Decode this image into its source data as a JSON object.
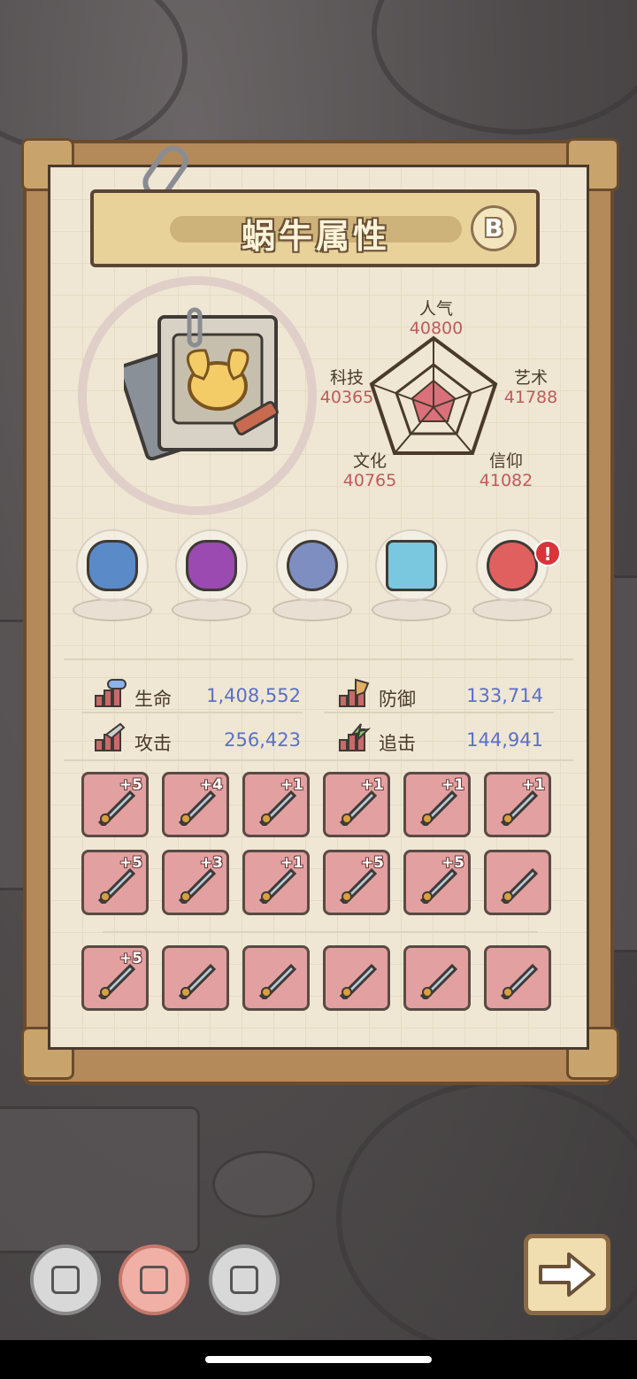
{
  "title": "蜗牛属性",
  "grade": "B",
  "attributes": [
    {
      "name": "人气",
      "value": "40800"
    },
    {
      "name": "艺术",
      "value": "41788"
    },
    {
      "name": "信仰",
      "value": "41082"
    },
    {
      "name": "文化",
      "value": "40765"
    },
    {
      "name": "科技",
      "value": "40365"
    }
  ],
  "relics": [
    {
      "icon": "maw-relic-icon",
      "color": "#5a8ac8"
    },
    {
      "icon": "shell-heart-relic-icon",
      "color": "#9a4ab0"
    },
    {
      "icon": "compass-relic-icon",
      "color": "#7e8ec0"
    },
    {
      "icon": "eye-tablet-relic-icon",
      "color": "#7ac8e0"
    },
    {
      "icon": "swirl-orb-relic-icon",
      "color": "#e06060"
    }
  ],
  "alert_badge": "!",
  "stats": {
    "hp": {
      "label": "生命",
      "value": "1,408,552"
    },
    "defense": {
      "label": "防御",
      "value": "133,714"
    },
    "attack": {
      "label": "攻击",
      "value": "256,423"
    },
    "chase": {
      "label": "追击",
      "value": "144,941"
    }
  },
  "equipment_rows": [
    [
      {
        "icon": "sword-icon",
        "level": "+5"
      },
      {
        "icon": "crossbow-icon",
        "level": "+4"
      },
      {
        "icon": "spiked-club-icon",
        "level": "+1"
      },
      {
        "icon": "flame-sword-icon",
        "level": "+1"
      },
      {
        "icon": "dagger-icon",
        "level": "+1"
      },
      {
        "icon": "axe-icon",
        "level": "+1"
      }
    ],
    [
      {
        "icon": "curved-knife-icon",
        "level": "+5"
      },
      {
        "icon": "serpent-staff-icon",
        "level": "+3"
      },
      {
        "icon": "trident-icon",
        "level": "+1"
      },
      {
        "icon": "gauntlet-icon",
        "level": "+5"
      },
      {
        "icon": "ring-icon",
        "level": "+5"
      },
      {
        "icon": "gold-ring-icon",
        "level": ""
      }
    ]
  ],
  "extra_row": [
    {
      "icon": "spear-icon",
      "level": "+5"
    },
    {
      "icon": "scythe-icon",
      "level": ""
    },
    {
      "icon": "totem-icon",
      "level": ""
    },
    {
      "icon": "feather-fan-icon",
      "level": ""
    },
    {
      "icon": "treasure-chest-icon",
      "level": ""
    },
    {
      "icon": "gatling-icon",
      "level": ""
    }
  ],
  "nav": [
    {
      "icon": "chip-icon",
      "active": false
    },
    {
      "icon": "chip-icon",
      "active": true
    },
    {
      "icon": "chip-icon",
      "active": false
    }
  ],
  "next_icon": "right-arrow-icon",
  "colors": {
    "value_blue": "#5b6fc8",
    "attr_red": "#c05a5a",
    "slot_pink": "#e2a0a0"
  }
}
